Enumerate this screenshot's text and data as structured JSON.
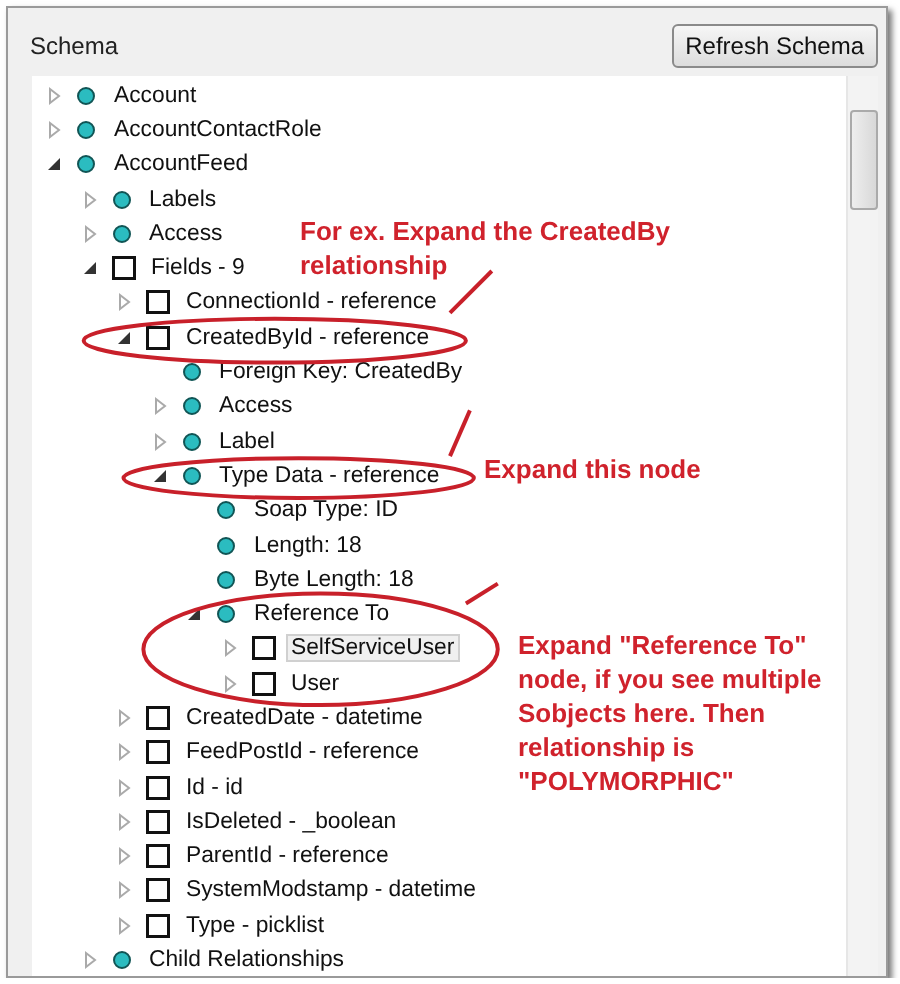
{
  "panel": {
    "title": "Schema",
    "refresh_button": "Refresh Schema"
  },
  "tree": [
    {
      "label": "Account",
      "kind": "dot",
      "expanded": false,
      "selected": false
    },
    {
      "label": "AccountContactRole",
      "kind": "dot",
      "expanded": false,
      "selected": false
    },
    {
      "label": "AccountFeed",
      "kind": "dot",
      "expanded": true,
      "selected": false,
      "children": [
        {
          "label": "Labels",
          "kind": "dot",
          "expanded": false,
          "selected": false
        },
        {
          "label": "Access",
          "kind": "dot",
          "expanded": false,
          "selected": false
        },
        {
          "label": "Fields - 9",
          "kind": "square",
          "expanded": true,
          "selected": false,
          "children": [
            {
              "label": "ConnectionId - reference",
              "kind": "square",
              "expanded": false,
              "selected": false
            },
            {
              "label": "CreatedById - reference",
              "kind": "square",
              "expanded": true,
              "selected": false,
              "children": [
                {
                  "label": "Foreign Key: CreatedBy",
                  "kind": "dot",
                  "selected": false
                },
                {
                  "label": "Access",
                  "kind": "dot",
                  "expanded": false,
                  "selected": false
                },
                {
                  "label": "Label",
                  "kind": "dot",
                  "expanded": false,
                  "selected": false
                },
                {
                  "label": "Type Data - reference",
                  "kind": "dot",
                  "expanded": true,
                  "selected": false,
                  "children": [
                    {
                      "label": "Soap Type: ID",
                      "kind": "dot",
                      "selected": false
                    },
                    {
                      "label": "Length: 18",
                      "kind": "dot",
                      "selected": false
                    },
                    {
                      "label": "Byte Length: 18",
                      "kind": "dot",
                      "selected": false
                    },
                    {
                      "label": "Reference To",
                      "kind": "dot",
                      "expanded": true,
                      "selected": false,
                      "children": [
                        {
                          "label": "SelfServiceUser",
                          "kind": "square",
                          "expanded": false,
                          "selected": true
                        },
                        {
                          "label": "User",
                          "kind": "square",
                          "expanded": false,
                          "selected": false
                        }
                      ]
                    }
                  ]
                }
              ]
            },
            {
              "label": "CreatedDate - datetime",
              "kind": "square",
              "expanded": false,
              "selected": false
            },
            {
              "label": "FeedPostId - reference",
              "kind": "square",
              "expanded": false,
              "selected": false
            },
            {
              "label": "Id - id",
              "kind": "square",
              "expanded": false,
              "selected": false
            },
            {
              "label": "IsDeleted - _boolean",
              "kind": "square",
              "expanded": false,
              "selected": false
            },
            {
              "label": "ParentId - reference",
              "kind": "square",
              "expanded": false,
              "selected": false
            },
            {
              "label": "SystemModstamp - datetime",
              "kind": "square",
              "expanded": false,
              "selected": false
            },
            {
              "label": "Type - picklist",
              "kind": "square",
              "expanded": false,
              "selected": false
            }
          ]
        },
        {
          "label": "Child Relationships",
          "kind": "dot",
          "expanded": false,
          "selected": false
        }
      ]
    }
  ],
  "annotations": [
    {
      "text": "For ex. Expand the CreatedBy relationship"
    },
    {
      "text": "Expand this node"
    },
    {
      "text": "Expand \"Reference To\" node, if you see multiple Sobjects here. Then relationship is \"POLYMORPHIC\""
    }
  ]
}
